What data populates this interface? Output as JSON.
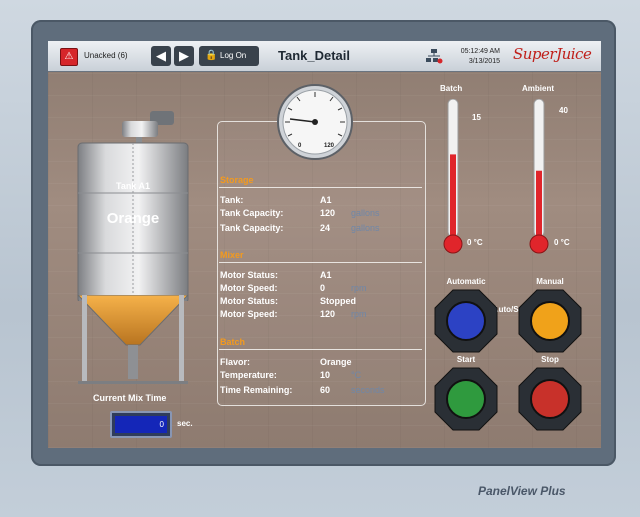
{
  "topbar": {
    "alarm_label": "Unacked (6)",
    "logon_label": "Log On",
    "screen_title": "Tank_Detail",
    "time": "05:12:49 AM",
    "date": "3/13/2015",
    "logo_text": "SuperJuice"
  },
  "tank": {
    "name": "Tank A1",
    "contents": "Orange"
  },
  "gauge": {
    "min_label": "0",
    "max_label": "120"
  },
  "storage": {
    "title": "Storage",
    "rows": [
      {
        "label": "Tank:",
        "value": "A1",
        "unit": ""
      },
      {
        "label": "Tank Capacity:",
        "value": "120",
        "unit": "gallons"
      },
      {
        "label": "Tank Capacity:",
        "value": "24",
        "unit": "gallons"
      }
    ]
  },
  "mixer": {
    "title": "Mixer",
    "rows": [
      {
        "label": "Motor Status:",
        "value": "A1",
        "unit": ""
      },
      {
        "label": "Motor Speed:",
        "value": "0",
        "unit": "rpm"
      },
      {
        "label": "Motor Status:",
        "value": "Stopped",
        "unit": ""
      },
      {
        "label": "Motor Speed:",
        "value": "120",
        "unit": "rpm"
      }
    ]
  },
  "batch": {
    "title": "Batch",
    "rows": [
      {
        "label": "Flavor:",
        "value": "Orange",
        "unit": ""
      },
      {
        "label": "Temperature:",
        "value": "10",
        "unit": "°C"
      },
      {
        "label": "Time Remaining:",
        "value": "60",
        "unit": "seconds"
      }
    ]
  },
  "thermometers": [
    {
      "label": "Batch",
      "max_label": "15",
      "min_label": "0 °C",
      "fill_fraction": 0.6
    },
    {
      "label": "Ambient",
      "max_label": "40",
      "min_label": "0 °C",
      "fill_fraction": 0.48
    }
  ],
  "motor_status": "Motor: Auto/Stopped",
  "buttons": [
    {
      "label": "Automatic",
      "color": "#2c42c4"
    },
    {
      "label": "Manual",
      "color": "#f0a21a"
    },
    {
      "label": "Start",
      "color": "#2f9a3e"
    },
    {
      "label": "Stop",
      "color": "#c8312a"
    }
  ],
  "mix_time": {
    "label": "Current Mix Time",
    "value": "0",
    "unit": "sec."
  },
  "brand": "PanelView Plus",
  "colors": {
    "accent_orange": "#f39a1e",
    "unit_blue": "#6f87a8",
    "thermo_red": "#e0252b"
  }
}
